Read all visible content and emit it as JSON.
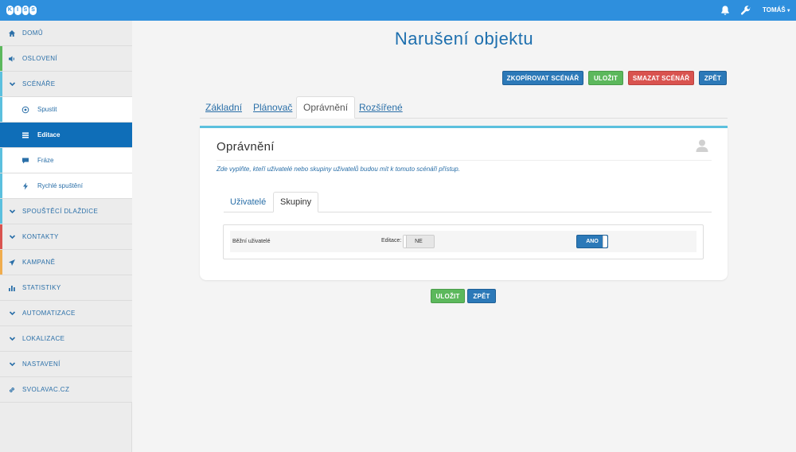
{
  "app": {
    "logo_letters": [
      "K",
      "I",
      "S",
      "S"
    ]
  },
  "topbar": {
    "user": "TOMÁŠ",
    "icons": [
      "bell-icon",
      "wrench-icon"
    ]
  },
  "sidebar": {
    "collapse_icon": "chevron-left-icon",
    "items": [
      {
        "label": "DOMŮ",
        "icon": "home-icon",
        "stripe": ""
      },
      {
        "label": "OSLOVENÍ",
        "icon": "speaker-icon",
        "stripe": "#5cb85c"
      },
      {
        "label": "SCÉNÁŘE",
        "icon": "chevron-down-icon",
        "stripe": "#5bc0de"
      },
      {
        "label": "Spustit",
        "icon": "play-circle-icon"
      },
      {
        "label": "Editace",
        "icon": "list-icon"
      },
      {
        "label": "Fráze",
        "icon": "comment-icon"
      },
      {
        "label": "Rychlé spuštění",
        "icon": "bolt-icon"
      },
      {
        "label": "SPOUŠTĚCÍ DLAŽDICE",
        "icon": "chevron-down-icon",
        "stripe": "#5bc0de"
      },
      {
        "label": "KONTAKTY",
        "icon": "chevron-down-icon",
        "stripe": "#d9534f"
      },
      {
        "label": "KAMPANĚ",
        "icon": "send-icon",
        "stripe": "#f0ad4e"
      },
      {
        "label": "STATISTIKY",
        "icon": "bar-chart-icon",
        "stripe": ""
      },
      {
        "label": "AUTOMATIZACE",
        "icon": "chevron-down-icon",
        "stripe": ""
      },
      {
        "label": "LOKALIZACE",
        "icon": "chevron-down-icon",
        "stripe": ""
      },
      {
        "label": "NASTAVENÍ",
        "icon": "chevron-down-icon",
        "stripe": ""
      },
      {
        "label": "SVOLAVAC.CZ",
        "icon": "link-icon",
        "stripe": ""
      }
    ]
  },
  "page": {
    "title": "Narušení objektu"
  },
  "toolbar": {
    "copy_label": "ZKOPÍROVAT SCÉNÁŘ",
    "save_label": "ULOŽIT",
    "delete_label": "SMAZAT SCÉNÁŘ",
    "back_label": "ZPĚT"
  },
  "tabs": [
    "Základní",
    "Plánovač",
    "Oprávnění",
    "Rozšířené"
  ],
  "card": {
    "title": "Oprávnění",
    "description": "Zde vyplňte, kteří uživatelé nebo skupiny uživatelů budou mít k tomuto scénáři přístup.",
    "subtabs": [
      "Uživatelé",
      "Skupiny"
    ],
    "row": {
      "label": "Běžní uživatelé",
      "edit_label": "Editace:",
      "edit_value": "NE",
      "access_value": "ANO"
    }
  },
  "footer": {
    "save_label": "ULOŽIT",
    "back_label": "ZPĚT"
  },
  "colors": {
    "accent": "#2e8fdd",
    "primary": "#2c79b8",
    "success": "#5cb85c",
    "danger": "#d9534f",
    "info": "#5bc0de"
  }
}
